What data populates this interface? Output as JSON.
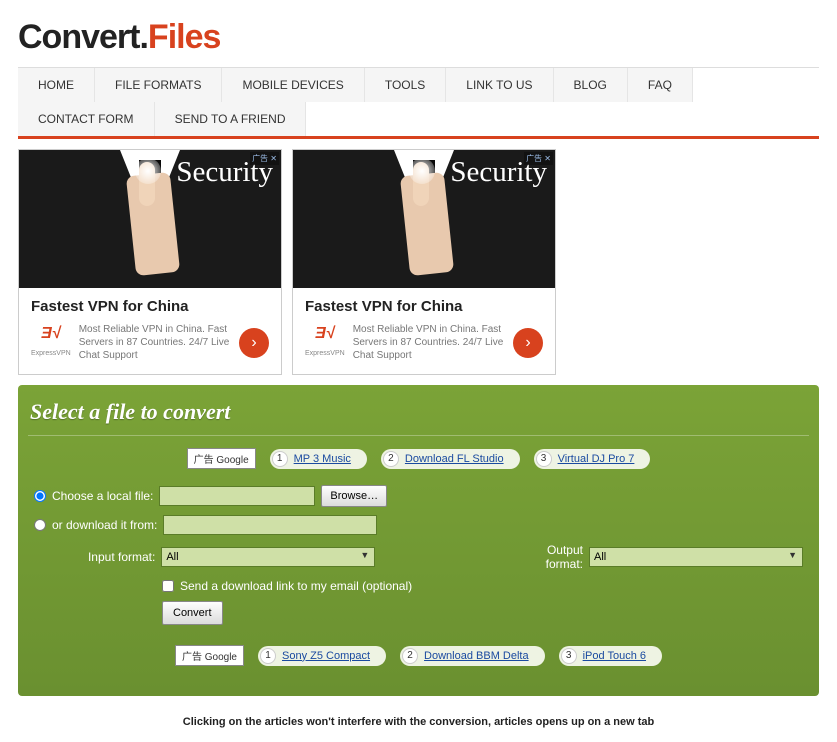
{
  "logo": {
    "part1": "Convert.",
    "part2": "Files"
  },
  "nav": {
    "items": [
      "HOME",
      "FILE FORMATS",
      "MOBILE DEVICES",
      "TOOLS",
      "LINK TO US",
      "BLOG",
      "FAQ",
      "CONTACT FORM",
      "SEND TO A FRIEND"
    ]
  },
  "ads": [
    {
      "topword": "Security",
      "corner": "广告 ✕",
      "title": "Fastest VPN for China",
      "iconTop": "Ǝ√",
      "iconBottom": "ExpressVPN",
      "desc": "Most Reliable VPN in China. Fast Servers in 87 Countries. 24/7 Live Chat Support",
      "arrow": "›"
    },
    {
      "topword": "Security",
      "corner": "广告 ✕",
      "title": "Fastest VPN for China",
      "iconTop": "Ǝ√",
      "iconBottom": "ExpressVPN",
      "desc": "Most Reliable VPN in China. Fast Servers in 87 Countries. 24/7 Live Chat Support",
      "arrow": "›"
    }
  ],
  "panel": {
    "title": "Select a file to convert",
    "googleLabel": "广告 Google",
    "pillsTop": [
      {
        "n": "1",
        "t": "MP 3 Music"
      },
      {
        "n": "2",
        "t": "Download FL Studio"
      },
      {
        "n": "3",
        "t": "Virtual DJ Pro 7"
      }
    ],
    "pillsBottom": [
      {
        "n": "1",
        "t": "Sony Z5 Compact"
      },
      {
        "n": "2",
        "t": "Download BBM Delta"
      },
      {
        "n": "3",
        "t": "iPod Touch 6"
      }
    ],
    "form": {
      "chooseLabel": "Choose a local file:",
      "browse": "Browse…",
      "downloadLabel": "or download it from:",
      "inputFormatLabel": "Input format:",
      "inputFormatValue": "All",
      "outputFormatLabel": "Output format:",
      "outputFormatValue": "All",
      "emailLabel": "Send a download link to my email (optional)",
      "convert": "Convert"
    }
  },
  "footnote": "Clicking on the articles won't interfere with the conversion, articles opens up on a new tab"
}
